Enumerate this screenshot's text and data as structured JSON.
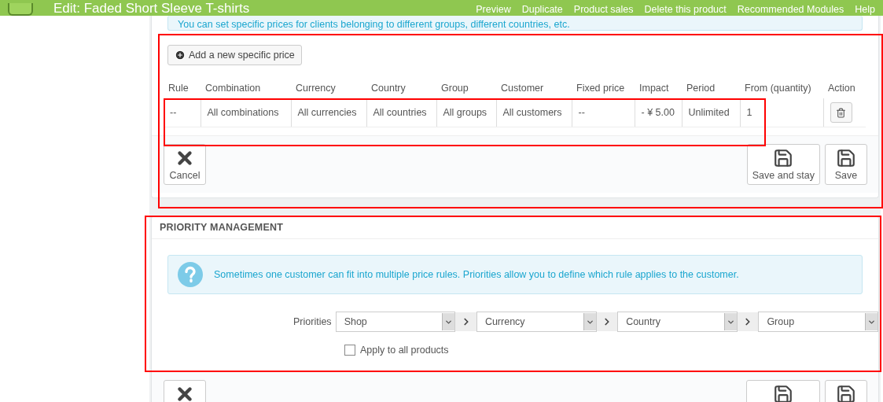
{
  "header": {
    "title": "Edit: Faded Short Sleeve T-shirts",
    "actions": [
      "Preview",
      "Duplicate",
      "Product sales",
      "Delete this product",
      "Recommended Modules",
      "Help"
    ]
  },
  "specific_prices": {
    "info": "You can set specific prices for clients belonging to different groups, different countries, etc.",
    "add_button": "Add a new specific price",
    "columns": [
      "Rule",
      "Combination",
      "Currency",
      "Country",
      "Group",
      "Customer",
      "Fixed price",
      "Impact",
      "Period",
      "From (quantity)",
      "Action"
    ],
    "rows": [
      {
        "cells": [
          "--",
          "All combinations",
          "All currencies",
          "All countries",
          "All groups",
          "All customers",
          "--",
          "- ¥ 5.00",
          "Unlimited",
          "1"
        ]
      }
    ],
    "cancel": "Cancel",
    "save_and_stay": "Save and stay",
    "save": "Save"
  },
  "priority": {
    "title": "PRIORITY MANAGEMENT",
    "info": "Sometimes one customer can fit into multiple price rules. Priorities allow you to define which rule applies to the customer.",
    "label": "Priorities",
    "selects": [
      "Shop",
      "Currency",
      "Country",
      "Group"
    ],
    "apply_all": {
      "label": "Apply to all products",
      "checked": false
    }
  }
}
